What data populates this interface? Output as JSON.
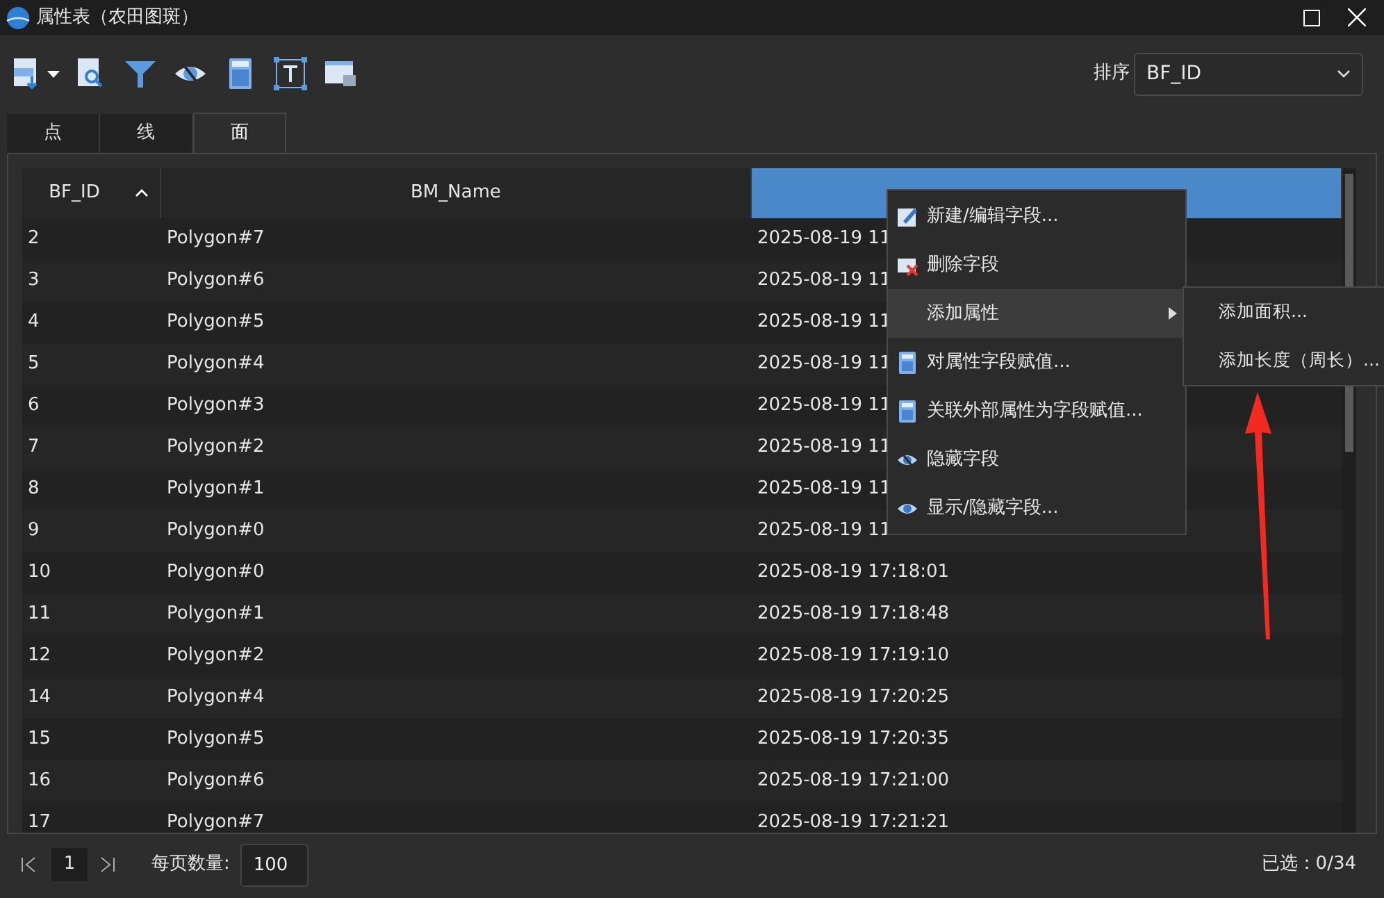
{
  "window": {
    "title": "属性表（农田图斑）"
  },
  "toolbar": {
    "sort_label": "排序",
    "sort_value": "BF_ID"
  },
  "tabs": [
    {
      "label": "点",
      "selected": false
    },
    {
      "label": "线",
      "selected": false
    },
    {
      "label": "面",
      "selected": true
    }
  ],
  "table": {
    "columns": [
      {
        "label": "BF_ID",
        "sorted": true,
        "selected": false
      },
      {
        "label": "BM_Name",
        "sorted": false,
        "selected": false
      },
      {
        "sorted": false,
        "selected": true
      }
    ],
    "rows": [
      [
        "2",
        "Polygon#7",
        "2025-08-19 11"
      ],
      [
        "3",
        "Polygon#6",
        "2025-08-19 11"
      ],
      [
        "4",
        "Polygon#5",
        "2025-08-19 11"
      ],
      [
        "5",
        "Polygon#4",
        "2025-08-19 11"
      ],
      [
        "6",
        "Polygon#3",
        "2025-08-19 11"
      ],
      [
        "7",
        "Polygon#2",
        "2025-08-19 11"
      ],
      [
        "8",
        "Polygon#1",
        "2025-08-19 11"
      ],
      [
        "9",
        "Polygon#0",
        "2025-08-19 11"
      ],
      [
        "10",
        "Polygon#0",
        "2025-08-19 17:18:01"
      ],
      [
        "11",
        "Polygon#1",
        "2025-08-19 17:18:48"
      ],
      [
        "12",
        "Polygon#2",
        "2025-08-19 17:19:10"
      ],
      [
        "14",
        "Polygon#4",
        "2025-08-19 17:20:25"
      ],
      [
        "15",
        "Polygon#5",
        "2025-08-19 17:20:35"
      ],
      [
        "16",
        "Polygon#6",
        "2025-08-19 17:21:00"
      ],
      [
        "17",
        "Polygon#7",
        "2025-08-19 17:21:21"
      ]
    ]
  },
  "context_menu": {
    "items": [
      {
        "label": "新建/编辑字段...",
        "kind": "edit",
        "highlighted": false
      },
      {
        "label": "删除字段",
        "kind": "delete",
        "highlighted": false
      },
      {
        "label": "添加属性",
        "kind": "submenu",
        "highlighted": true
      },
      {
        "label": "对属性字段赋值...",
        "kind": "calc",
        "highlighted": false
      },
      {
        "label": "关联外部属性为字段赋值...",
        "kind": "calc",
        "highlighted": false
      },
      {
        "label": "隐藏字段",
        "kind": "hide",
        "highlighted": false
      },
      {
        "label": "显示/隐藏字段...",
        "kind": "show",
        "highlighted": false
      }
    ],
    "submenu": [
      {
        "label": "添加面积..."
      },
      {
        "label": "添加长度（周长）..."
      }
    ]
  },
  "footer": {
    "page": "1",
    "page_size_label": "每页数量:",
    "page_size": "100",
    "selected_count": "已选：0/34"
  }
}
